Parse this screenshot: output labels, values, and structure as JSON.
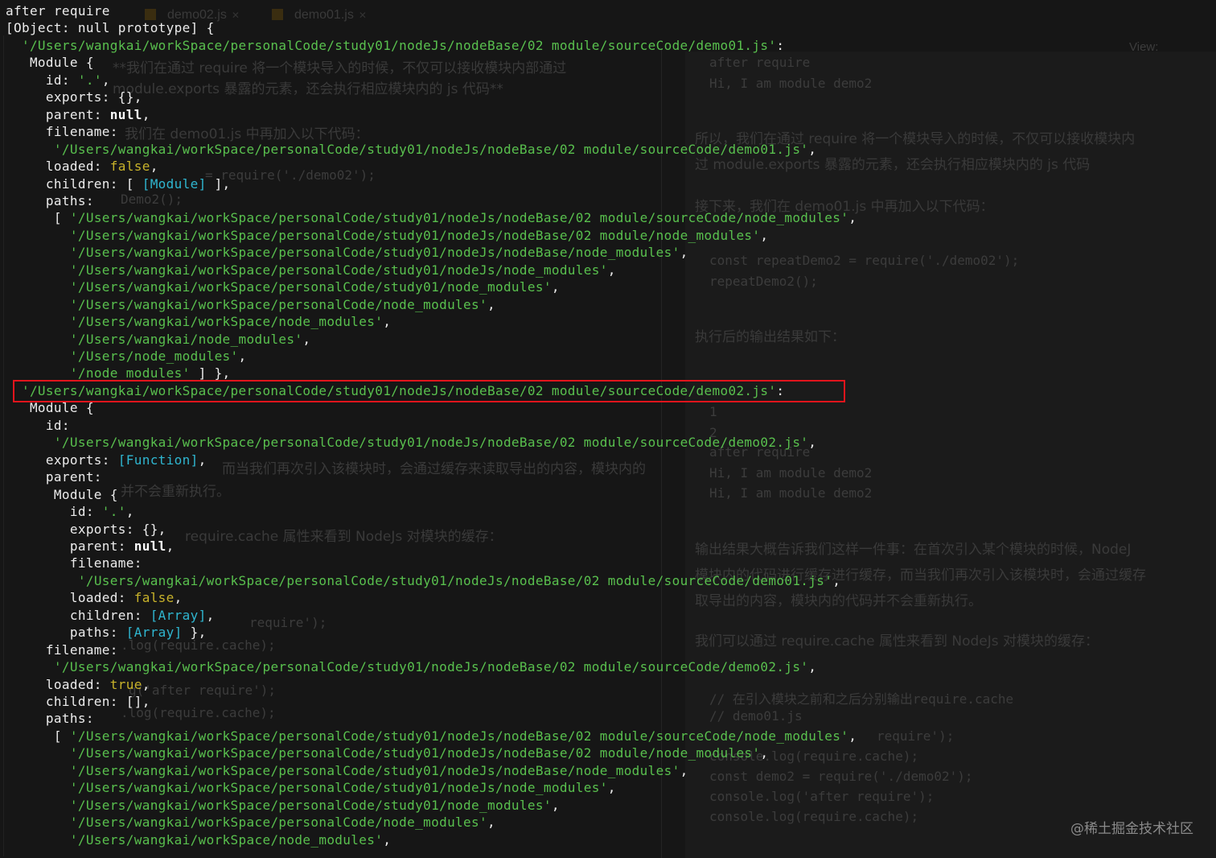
{
  "background_editor": {
    "tabs": [
      "demo02.js",
      "demo01.js"
    ],
    "view_label": "View:",
    "output_lines": [
      "after require",
      "Hi, I am module demo2"
    ],
    "para1_a": "所以，我们在通过 require 将一个模块导入的时候，不仅可以接收模块内",
    "para1_b": "过 module.exports 暴露的元素，还会执行相应模块内的 js 代码",
    "para2": "接下来，我们在 demo01.js 中再加入以下代码：",
    "code1": [
      "const repeatDemo2 = require('./demo02');",
      "repeatDemo2();"
    ],
    "para3": "执行后的输出结果如下：",
    "output2": [
      "after require",
      "1",
      "2",
      "after require",
      "Hi, I am module demo2",
      "Hi, I am module demo2"
    ],
    "para4_a": "输出结果大概告诉我们这样一件事：在首次引入某个模块的时候，NodeJ",
    "para4_b": "模块内的代码进行缓存进行缓存，而当我们再次引入该模块时，会通过缓存",
    "para4_c": "取导出的内容，模块内的代码并不会重新执行。",
    "para5": "我们可以通过 require.cache 属性来看到 NodeJs 对模块的缓存：",
    "code2": [
      "// 在引入模块之前和之后分别输出require.cache",
      "// demo01.js",
      "require');",
      "console.log(require.cache);",
      "const demo2 = require('./demo02');",
      "console.log('after require');",
      "console.log(require.cache);"
    ],
    "left_fragments": [
      "**我们在通过 require 将一个模块导入的时候，不仅可以接收模块内部通过",
      "module.exports 暴露的元素，还会执行相应模块内的 js 代码**",
      "我们在 demo01.js 中再加入以下代码：",
      "= require('./demo02');",
      "Demo2();",
      "而当我们再次引入该模块时，会通过缓存来读取导出的内容，模块内的",
      "并不会重新执行。",
      "require.cache 属性来看到 NodeJs 对模块的缓存：",
      "require');",
      ".log(require.cache);",
      "g('after require');",
      ".log(require.cache);"
    ]
  },
  "watermark": "@稀土掘金技术社区",
  "terminal": {
    "lines": [
      [
        {
          "t": "after require"
        }
      ],
      [
        {
          "t": "[Object: null prototype] {"
        }
      ],
      [
        {
          "t": "  "
        },
        {
          "t": "'/Users/wangkai/workSpace/personalCode/study01/nodeJs/nodeBase/02 module/sourceCode/demo01.js'",
          "c": "s"
        },
        {
          "t": ":"
        }
      ],
      [
        {
          "t": "   Module {"
        }
      ],
      [
        {
          "t": "     id: "
        },
        {
          "t": "'.'",
          "c": "s"
        },
        {
          "t": ","
        }
      ],
      [
        {
          "t": "     exports: {},"
        }
      ],
      [
        {
          "t": "     parent: "
        },
        {
          "t": "null",
          "c": "b"
        },
        {
          "t": ","
        }
      ],
      [
        {
          "t": "     filename:"
        }
      ],
      [
        {
          "t": "      "
        },
        {
          "t": "'/Users/wangkai/workSpace/personalCode/study01/nodeJs/nodeBase/02 module/sourceCode/demo01.js'",
          "c": "s"
        },
        {
          "t": ","
        }
      ],
      [
        {
          "t": "     loaded: "
        },
        {
          "t": "false",
          "c": "ye"
        },
        {
          "t": ","
        }
      ],
      [
        {
          "t": "     children: [ "
        },
        {
          "t": "[Module]",
          "c": "cy"
        },
        {
          "t": " ],"
        }
      ],
      [
        {
          "t": "     paths:"
        }
      ],
      [
        {
          "t": "      [ "
        },
        {
          "t": "'/Users/wangkai/workSpace/personalCode/study01/nodeJs/nodeBase/02 module/sourceCode/node_modules'",
          "c": "s"
        },
        {
          "t": ","
        }
      ],
      [
        {
          "t": "        "
        },
        {
          "t": "'/Users/wangkai/workSpace/personalCode/study01/nodeJs/nodeBase/02 module/node_modules'",
          "c": "s"
        },
        {
          "t": ","
        }
      ],
      [
        {
          "t": "        "
        },
        {
          "t": "'/Users/wangkai/workSpace/personalCode/study01/nodeJs/nodeBase/node_modules'",
          "c": "s"
        },
        {
          "t": ","
        }
      ],
      [
        {
          "t": "        "
        },
        {
          "t": "'/Users/wangkai/workSpace/personalCode/study01/nodeJs/node_modules'",
          "c": "s"
        },
        {
          "t": ","
        }
      ],
      [
        {
          "t": "        "
        },
        {
          "t": "'/Users/wangkai/workSpace/personalCode/study01/node_modules'",
          "c": "s"
        },
        {
          "t": ","
        }
      ],
      [
        {
          "t": "        "
        },
        {
          "t": "'/Users/wangkai/workSpace/personalCode/node_modules'",
          "c": "s"
        },
        {
          "t": ","
        }
      ],
      [
        {
          "t": "        "
        },
        {
          "t": "'/Users/wangkai/workSpace/node_modules'",
          "c": "s"
        },
        {
          "t": ","
        }
      ],
      [
        {
          "t": "        "
        },
        {
          "t": "'/Users/wangkai/node_modules'",
          "c": "s"
        },
        {
          "t": ","
        }
      ],
      [
        {
          "t": "        "
        },
        {
          "t": "'/Users/node_modules'",
          "c": "s"
        },
        {
          "t": ","
        }
      ],
      [
        {
          "t": "        "
        },
        {
          "t": "'/node_modules'",
          "c": "s"
        },
        {
          "t": " ] },"
        }
      ],
      [
        {
          "t": "  "
        },
        {
          "t": "'/Users/wangkai/workSpace/personalCode/study01/nodeJs/nodeBase/02 module/sourceCode/demo02.js'",
          "c": "s"
        },
        {
          "t": ":"
        }
      ],
      [
        {
          "t": "   Module {"
        }
      ],
      [
        {
          "t": "     id:"
        }
      ],
      [
        {
          "t": "      "
        },
        {
          "t": "'/Users/wangkai/workSpace/personalCode/study01/nodeJs/nodeBase/02 module/sourceCode/demo02.js'",
          "c": "s"
        },
        {
          "t": ","
        }
      ],
      [
        {
          "t": "     exports: "
        },
        {
          "t": "[Function]",
          "c": "cy"
        },
        {
          "t": ","
        }
      ],
      [
        {
          "t": "     parent:"
        }
      ],
      [
        {
          "t": "      Module {"
        }
      ],
      [
        {
          "t": "        id: "
        },
        {
          "t": "'.'",
          "c": "s"
        },
        {
          "t": ","
        }
      ],
      [
        {
          "t": "        exports: {},"
        }
      ],
      [
        {
          "t": "        parent: "
        },
        {
          "t": "null",
          "c": "b"
        },
        {
          "t": ","
        }
      ],
      [
        {
          "t": "        filename:"
        }
      ],
      [
        {
          "t": "         "
        },
        {
          "t": "'/Users/wangkai/workSpace/personalCode/study01/nodeJs/nodeBase/02 module/sourceCode/demo01.js'",
          "c": "s"
        },
        {
          "t": ","
        }
      ],
      [
        {
          "t": "        loaded: "
        },
        {
          "t": "false",
          "c": "ye"
        },
        {
          "t": ","
        }
      ],
      [
        {
          "t": "        children: "
        },
        {
          "t": "[Array]",
          "c": "cy"
        },
        {
          "t": ","
        }
      ],
      [
        {
          "t": "        paths: "
        },
        {
          "t": "[Array]",
          "c": "cy"
        },
        {
          "t": " },"
        }
      ],
      [
        {
          "t": "     filename:"
        }
      ],
      [
        {
          "t": "      "
        },
        {
          "t": "'/Users/wangkai/workSpace/personalCode/study01/nodeJs/nodeBase/02 module/sourceCode/demo02.js'",
          "c": "s"
        },
        {
          "t": ","
        }
      ],
      [
        {
          "t": "     loaded: "
        },
        {
          "t": "true",
          "c": "ye"
        },
        {
          "t": ","
        }
      ],
      [
        {
          "t": "     children: [],"
        }
      ],
      [
        {
          "t": "     paths:"
        }
      ],
      [
        {
          "t": "      [ "
        },
        {
          "t": "'/Users/wangkai/workSpace/personalCode/study01/nodeJs/nodeBase/02 module/sourceCode/node_modules'",
          "c": "s"
        },
        {
          "t": ","
        }
      ],
      [
        {
          "t": "        "
        },
        {
          "t": "'/Users/wangkai/workSpace/personalCode/study01/nodeJs/nodeBase/02 module/node_modules'",
          "c": "s"
        },
        {
          "t": ","
        }
      ],
      [
        {
          "t": "        "
        },
        {
          "t": "'/Users/wangkai/workSpace/personalCode/study01/nodeJs/nodeBase/node_modules'",
          "c": "s"
        },
        {
          "t": ","
        }
      ],
      [
        {
          "t": "        "
        },
        {
          "t": "'/Users/wangkai/workSpace/personalCode/study01/nodeJs/node_modules'",
          "c": "s"
        },
        {
          "t": ","
        }
      ],
      [
        {
          "t": "        "
        },
        {
          "t": "'/Users/wangkai/workSpace/personalCode/study01/node_modules'",
          "c": "s"
        },
        {
          "t": ","
        }
      ],
      [
        {
          "t": "        "
        },
        {
          "t": "'/Users/wangkai/workSpace/personalCode/node_modules'",
          "c": "s"
        },
        {
          "t": ","
        }
      ],
      [
        {
          "t": "        "
        },
        {
          "t": "'/Users/wangkai/workSpace/node_modules'",
          "c": "s"
        },
        {
          "t": ","
        }
      ]
    ]
  },
  "colors": {
    "string": "#59c04e",
    "special": "#2fb6d0",
    "boolean": "#c8b22a",
    "highlight_box": "#e2141c",
    "background": "#161616"
  }
}
